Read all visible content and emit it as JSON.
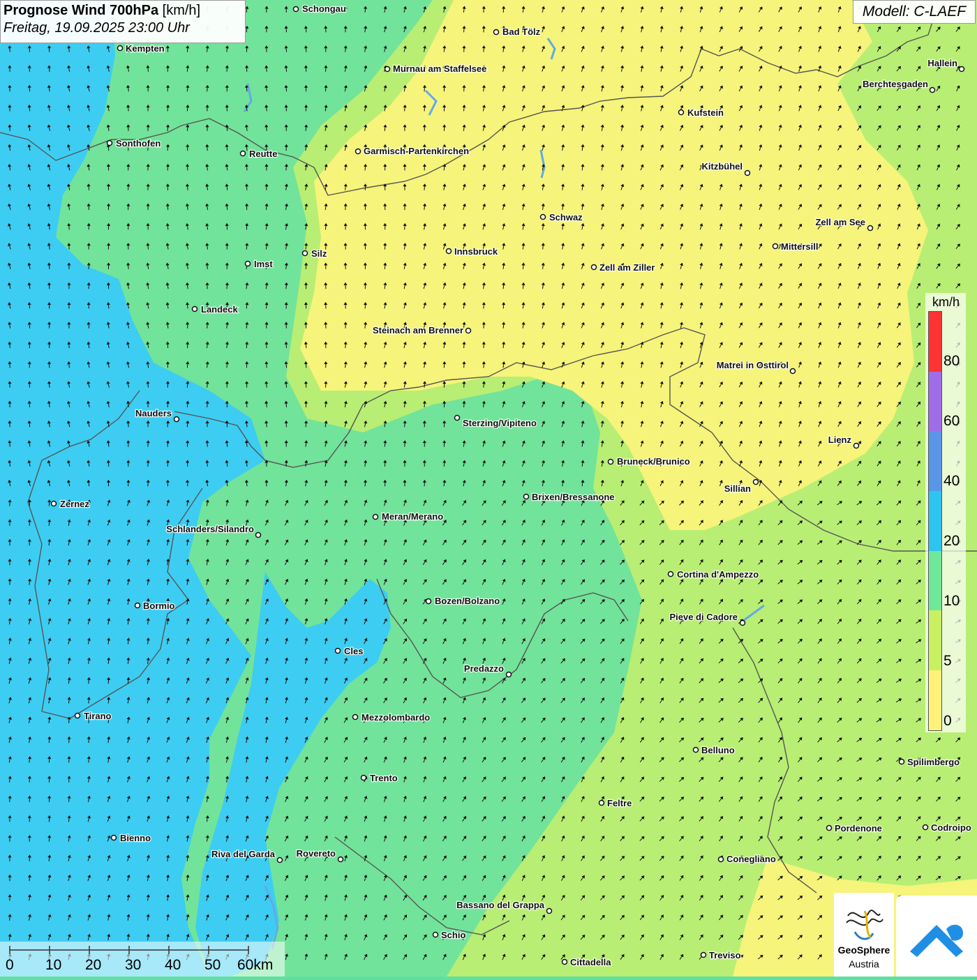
{
  "title": {
    "bold": "Prognose Wind 700hPa",
    "unit": "[km/h]",
    "datetime": "Freitag, 19.09.2025 23:00 Uhr"
  },
  "model": "Modell: C-LAEF",
  "legend": {
    "unit": "km/h",
    "ticks": [
      "80",
      "60",
      "40",
      "20",
      "10",
      "5",
      "0"
    ],
    "colors": [
      "#ff3333",
      "#a06de8",
      "#5a96e8",
      "#2ec4f0",
      "#6fe89a",
      "#c8f060",
      "#fff27a"
    ]
  },
  "scale": {
    "labels": [
      "0",
      "10",
      "20",
      "30",
      "40",
      "50",
      "60km"
    ]
  },
  "logo": {
    "line1": "GeoSphere",
    "line2": "Austria"
  },
  "colors": {
    "zone_cyan": "#3dcdf2",
    "zone_green": "#72e39a",
    "zone_lightgreen": "#b8ee73",
    "zone_yellow": "#f6f47a",
    "border": "#555555",
    "lake": "#63a9e6"
  },
  "cities": [
    {
      "name": "Schongau"
    },
    {
      "name": "Kempten"
    },
    {
      "name": "Bad Tölz"
    },
    {
      "name": "Murnau am Staffelsee"
    },
    {
      "name": "Hallein"
    },
    {
      "name": "Berchtesgaden"
    },
    {
      "name": "Kufstein"
    },
    {
      "name": "Sonthofen"
    },
    {
      "name": "Reutte"
    },
    {
      "name": "Garmisch-Partenkirchen"
    },
    {
      "name": "Kitzbühel"
    },
    {
      "name": "Schwaz"
    },
    {
      "name": "Zell am See"
    },
    {
      "name": "Mittersill"
    },
    {
      "name": "Imst"
    },
    {
      "name": "Silz"
    },
    {
      "name": "Innsbruck"
    },
    {
      "name": "Zell am Ziller"
    },
    {
      "name": "Landeck"
    },
    {
      "name": "Steinach am Brenner"
    },
    {
      "name": "Matrei in Osttirol"
    },
    {
      "name": "Nauders"
    },
    {
      "name": "Sterzing/Vipiteno"
    },
    {
      "name": "Lienz"
    },
    {
      "name": "Bruneck/Brunico"
    },
    {
      "name": "Sillian"
    },
    {
      "name": "Zernez"
    },
    {
      "name": "Brixen/Bressanone"
    },
    {
      "name": "Meran/Merano"
    },
    {
      "name": "Schlanders/Silandro"
    },
    {
      "name": "Cortina d'Ampezzo"
    },
    {
      "name": "Bormio"
    },
    {
      "name": "Bozen/Bolzano"
    },
    {
      "name": "Pieve di Cadore"
    },
    {
      "name": "Cles"
    },
    {
      "name": "Predazzo"
    },
    {
      "name": "Tirano"
    },
    {
      "name": "Mezzolombardo"
    },
    {
      "name": "Belluno"
    },
    {
      "name": "Spilimbergo"
    },
    {
      "name": "Trento"
    },
    {
      "name": "Feltre"
    },
    {
      "name": "Bienno"
    },
    {
      "name": "Pordenone"
    },
    {
      "name": "Codroipo"
    },
    {
      "name": "Riva del Garda"
    },
    {
      "name": "Rovereto"
    },
    {
      "name": "Conegliano"
    },
    {
      "name": "Bassano del Grappa"
    },
    {
      "name": "Schio"
    },
    {
      "name": "Treviso"
    },
    {
      "name": "Cittadella"
    }
  ]
}
